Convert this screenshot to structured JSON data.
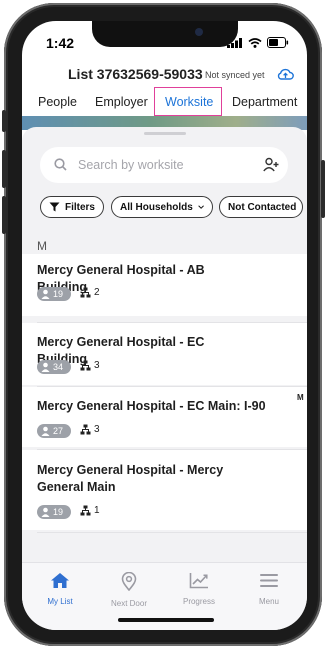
{
  "status_bar": {
    "time": "1:42"
  },
  "header": {
    "list_title": "List 37632569-59033",
    "sync_status": "Not synced yet"
  },
  "tabs": [
    {
      "label": "People",
      "active": false
    },
    {
      "label": "Employer",
      "active": false
    },
    {
      "label": "Worksite",
      "active": true
    },
    {
      "label": "Department",
      "active": false
    }
  ],
  "search": {
    "placeholder": "Search by worksite"
  },
  "filters": {
    "filter_label": "Filters",
    "households_label": "All Households",
    "contact_label": "Not Contacted"
  },
  "section_letter": "M",
  "worksites": [
    {
      "name": "Mercy General Hospital - AB Building",
      "people_count": "19",
      "household_count": "2"
    },
    {
      "name": "Mercy General Hospital - EC Building",
      "people_count": "34",
      "household_count": "3"
    },
    {
      "name": "Mercy General Hospital - EC Main: I-90",
      "people_count": "27",
      "household_count": "3"
    },
    {
      "name": "Mercy General Hospital - Mercy General Main",
      "people_count": "19",
      "household_count": "1"
    }
  ],
  "index_letter": "M",
  "bottom_nav": [
    {
      "label": "My List",
      "icon": "home-icon",
      "active": true
    },
    {
      "label": "Next Door",
      "icon": "location-pin-icon",
      "active": false
    },
    {
      "label": "Progress",
      "icon": "chart-icon",
      "active": false
    },
    {
      "label": "Menu",
      "icon": "menu-icon",
      "active": false
    }
  ],
  "colors": {
    "accent": "#1d74d8",
    "tab_highlight_box": "#e0409a",
    "badge": "#9da1a8"
  }
}
